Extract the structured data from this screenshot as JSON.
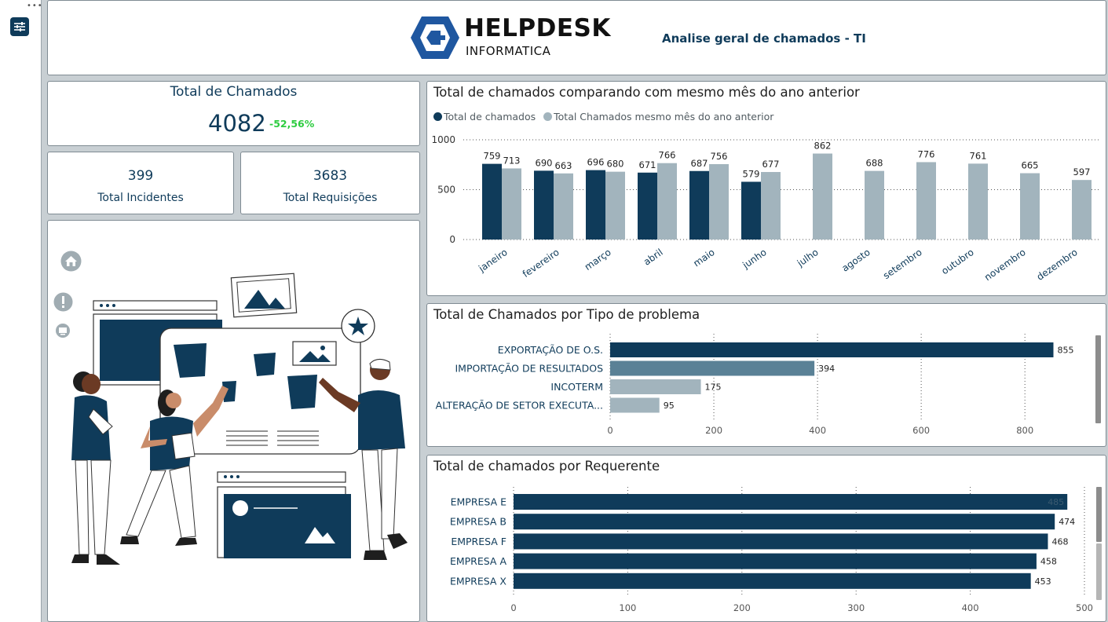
{
  "header": {
    "logo_main": "HELPDESK",
    "logo_sub": "INFORMATICA",
    "subtitle": "Analise geral de chamados - TI"
  },
  "colors": {
    "dark": "#0f3b5a",
    "light": "#a2b4bd",
    "mid": "#5a8196",
    "soft": "#a2b4bd",
    "positive": "#2ecc40"
  },
  "kpi": {
    "total": {
      "title": "Total de Chamados",
      "value": "4082",
      "change": "-52,56%"
    },
    "incidents": {
      "value": "399",
      "label": "Total Incidentes"
    },
    "requests": {
      "value": "3683",
      "label": "Total Requisições"
    }
  },
  "chart_data": [
    {
      "type": "bar",
      "title": "Total de chamados comparando com mesmo mês do ano anterior",
      "categories": [
        "janeiro",
        "fevereiro",
        "março",
        "abril",
        "maio",
        "junho",
        "julho",
        "agosto",
        "setembro",
        "outubro",
        "novembro",
        "dezembro"
      ],
      "series": [
        {
          "name": "Total de chamados",
          "values": [
            759,
            690,
            696,
            671,
            687,
            579,
            null,
            null,
            null,
            null,
            null,
            null
          ]
        },
        {
          "name": "Total Chamados mesmo mês do ano anterior",
          "values": [
            713,
            663,
            680,
            766,
            756,
            677,
            862,
            688,
            776,
            761,
            665,
            597
          ]
        }
      ],
      "ylim": [
        0,
        1000
      ],
      "yticks": [
        0,
        500,
        1000
      ],
      "legend": "top-left",
      "grid": true
    },
    {
      "type": "bar",
      "orientation": "horizontal",
      "title": "Total de Chamados por Tipo de problema",
      "categories": [
        "EXPORTAÇÃO DE O.S.",
        "IMPORTAÇÃO DE RESULTADOS",
        "INCOTERM",
        "ALTERAÇÃO DE SETOR EXECUTA..."
      ],
      "values": [
        855,
        394,
        175,
        95
      ],
      "xlim": [
        0,
        880
      ],
      "xticks": [
        0,
        200,
        400,
        600,
        800
      ],
      "grid": true
    },
    {
      "type": "bar",
      "orientation": "horizontal",
      "title": "Total de chamados por Requerente",
      "categories": [
        "EMPRESA E",
        "EMPRESA B",
        "EMPRESA F",
        "EMPRESA A",
        "EMPRESA X"
      ],
      "values": [
        485,
        474,
        468,
        458,
        453
      ],
      "xlim": [
        0,
        500
      ],
      "xticks": [
        0,
        100,
        200,
        300,
        400,
        500
      ],
      "grid": true
    }
  ]
}
